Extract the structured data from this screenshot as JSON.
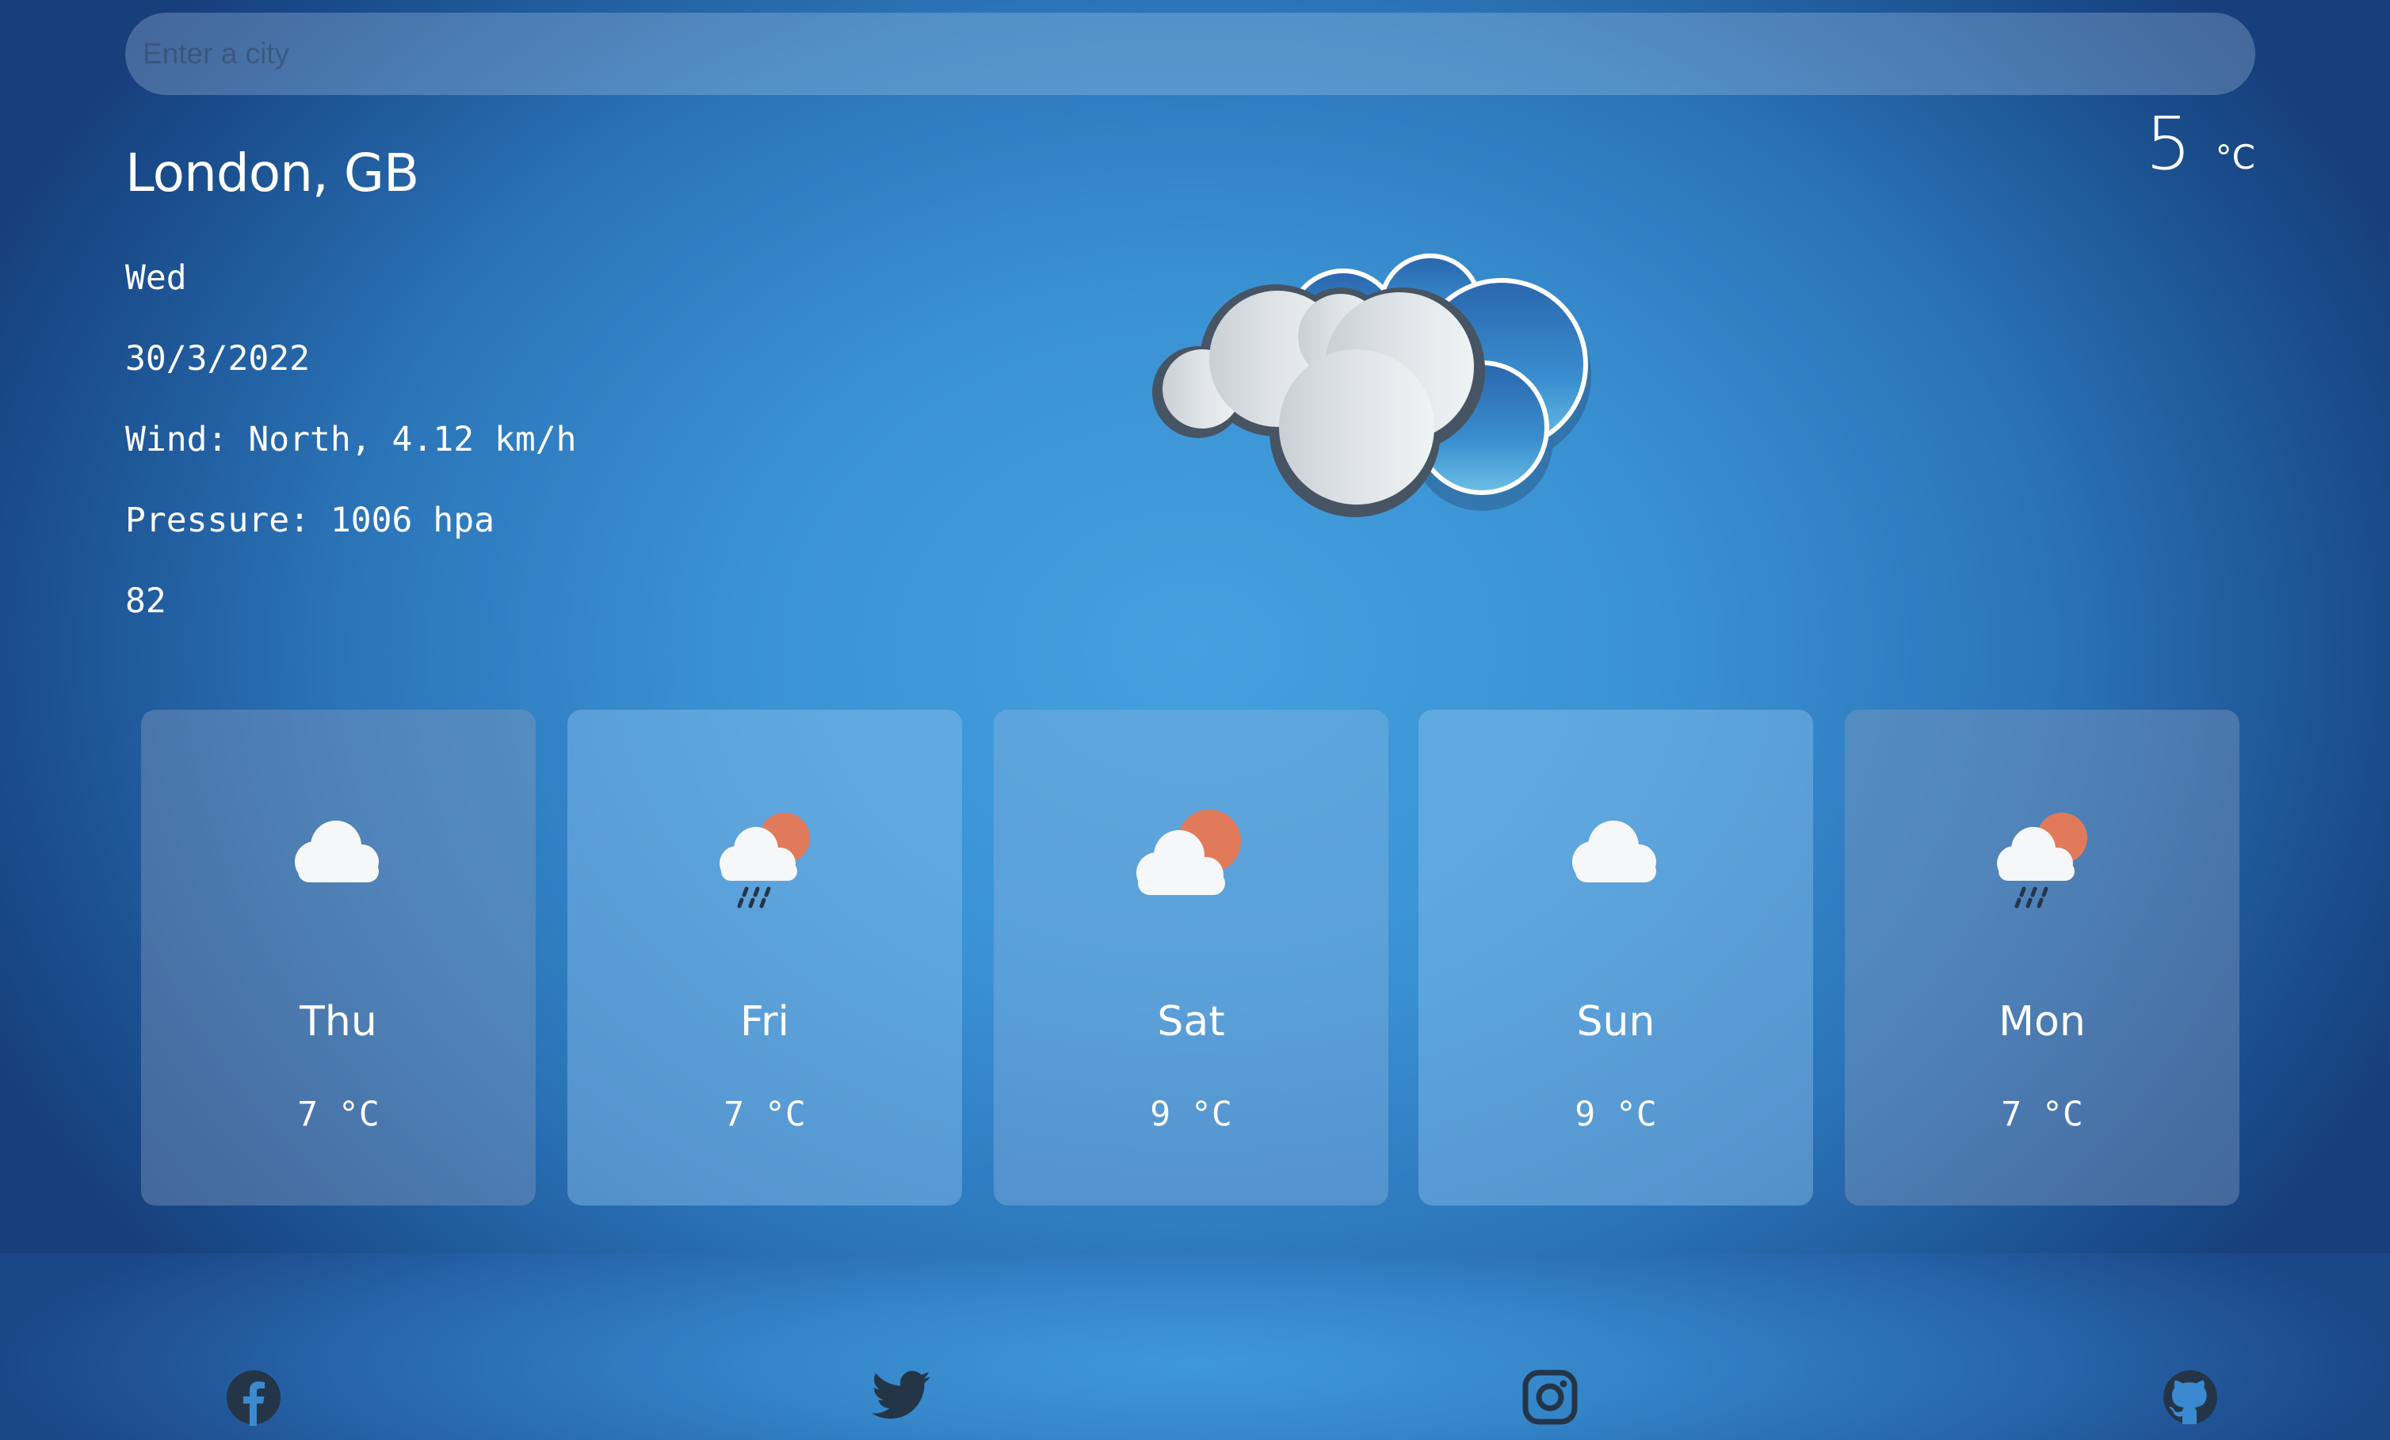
{
  "search": {
    "placeholder": "Enter a city",
    "value": ""
  },
  "current": {
    "city": "London, GB",
    "temperature": "5",
    "unit": "°C",
    "day": "Wed",
    "date": "30/3/2022",
    "wind": "Wind: North, 4.12 km/h",
    "pressure": "Pressure: 1006 hpa",
    "humidity": "82",
    "icon": "overcast-clouds-icon"
  },
  "forecast": [
    {
      "day": "Thu",
      "temp": "7 °C",
      "icon": "cloud-icon"
    },
    {
      "day": "Fri",
      "temp": "7 °C",
      "icon": "sun-cloud-rain-icon"
    },
    {
      "day": "Sat",
      "temp": "9 °C",
      "icon": "sun-cloud-icon"
    },
    {
      "day": "Sun",
      "temp": "9 °C",
      "icon": "cloud-icon"
    },
    {
      "day": "Mon",
      "temp": "7 °C",
      "icon": "sun-cloud-rain-icon"
    }
  ],
  "social": [
    "facebook-icon",
    "twitter-icon",
    "instagram-icon",
    "github-icon"
  ],
  "colors": {
    "background_center": "#44a0de",
    "background_edge": "#173f7c",
    "sun": "#e07a5a",
    "icon_dark": "#243548"
  }
}
